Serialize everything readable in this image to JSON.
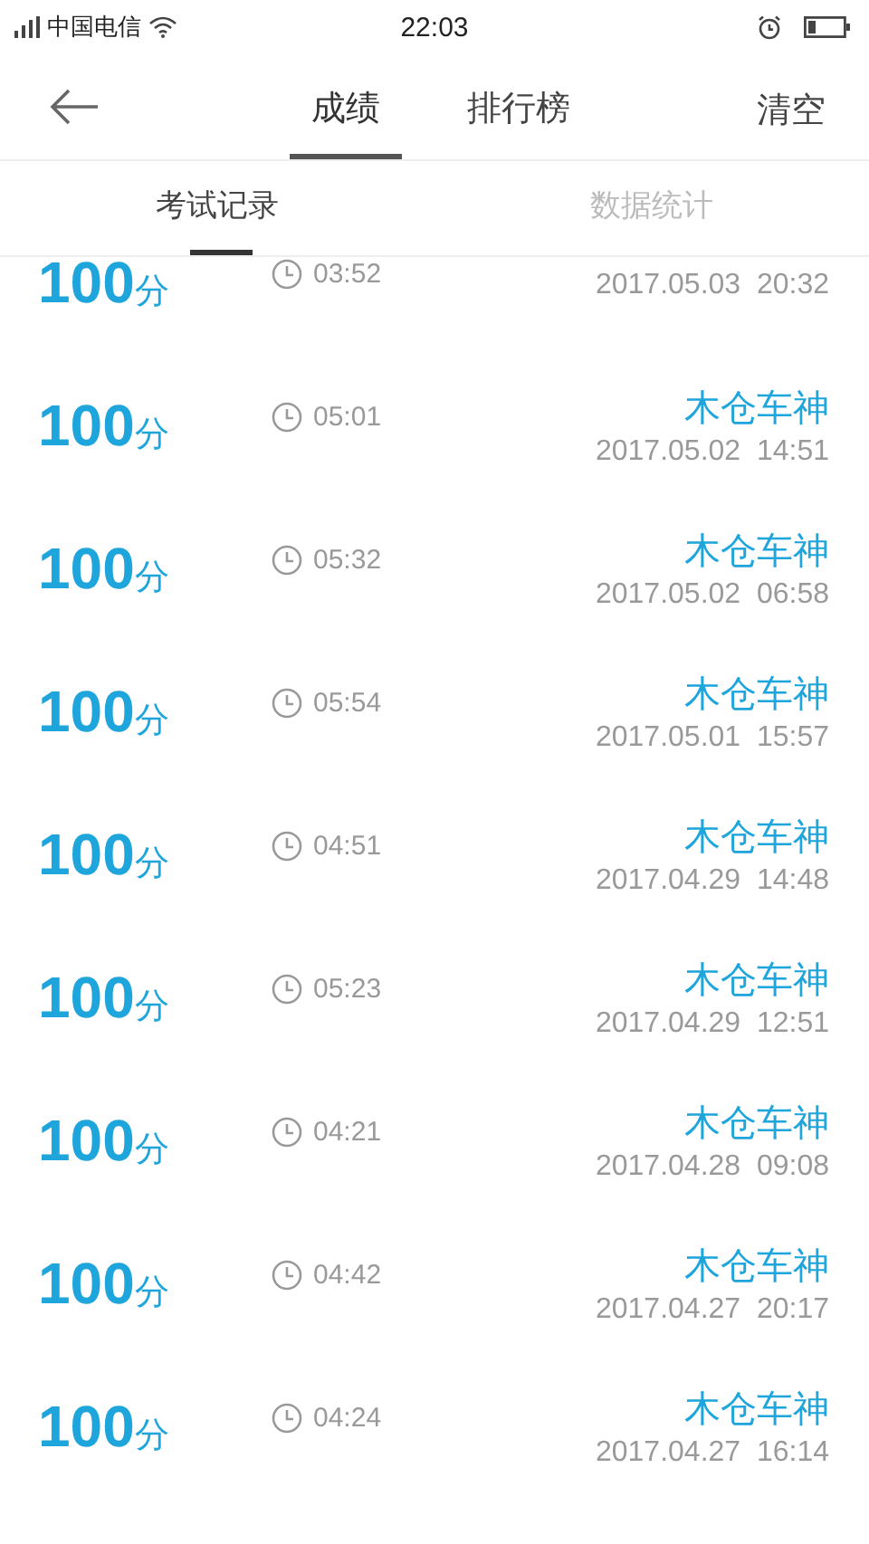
{
  "status_bar": {
    "carrier": "中国电信",
    "time": "22:03"
  },
  "header": {
    "tabs": [
      {
        "label": "成绩",
        "selected": true
      },
      {
        "label": "排行榜",
        "selected": false
      }
    ],
    "action": "清空"
  },
  "subtabs": [
    {
      "label": "考试记录",
      "selected": true
    },
    {
      "label": "数据统计",
      "selected": false
    }
  ],
  "records": [
    {
      "score": "100",
      "unit": "分",
      "duration": "03:52",
      "date": "2017.05.03",
      "time": "20:32"
    },
    {
      "score": "100",
      "unit": "分",
      "duration": "05:01",
      "name": "木仓车神",
      "date": "2017.05.02",
      "time": "14:51"
    },
    {
      "score": "100",
      "unit": "分",
      "duration": "05:32",
      "name": "木仓车神",
      "date": "2017.05.02",
      "time": "06:58"
    },
    {
      "score": "100",
      "unit": "分",
      "duration": "05:54",
      "name": "木仓车神",
      "date": "2017.05.01",
      "time": "15:57"
    },
    {
      "score": "100",
      "unit": "分",
      "duration": "04:51",
      "name": "木仓车神",
      "date": "2017.04.29",
      "time": "14:48"
    },
    {
      "score": "100",
      "unit": "分",
      "duration": "05:23",
      "name": "木仓车神",
      "date": "2017.04.29",
      "time": "12:51"
    },
    {
      "score": "100",
      "unit": "分",
      "duration": "04:21",
      "name": "木仓车神",
      "date": "2017.04.28",
      "time": "09:08"
    },
    {
      "score": "100",
      "unit": "分",
      "duration": "04:42",
      "name": "木仓车神",
      "date": "2017.04.27",
      "time": "20:17"
    },
    {
      "score": "100",
      "unit": "分",
      "duration": "04:24",
      "name": "木仓车神",
      "date": "2017.04.27",
      "time": "16:14"
    }
  ]
}
